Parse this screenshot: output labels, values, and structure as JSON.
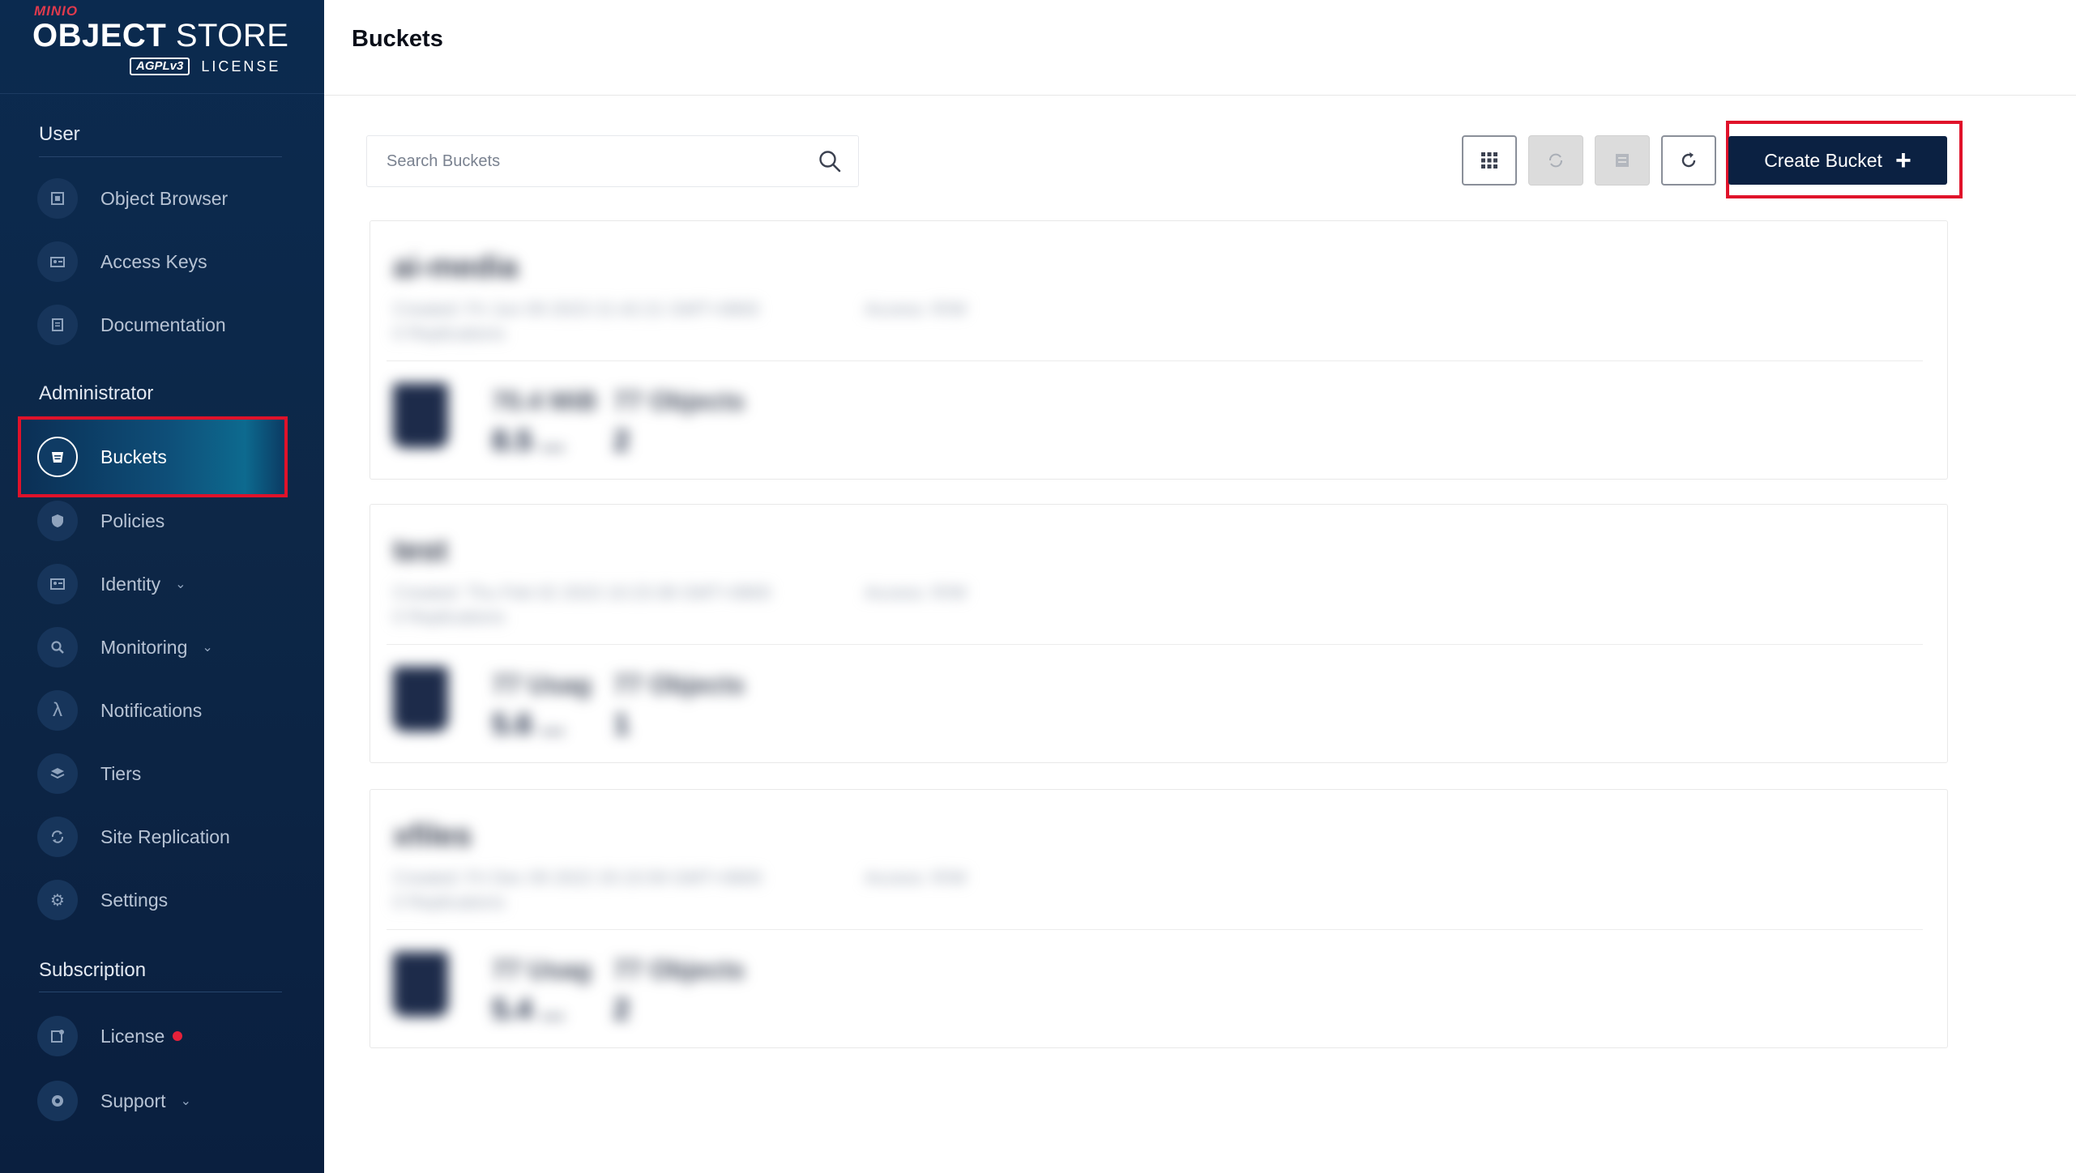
{
  "brand": {
    "minio": "MINIO",
    "title_bold": "OBJECT",
    "title_light": " STORE",
    "agpl": "AGPLv3",
    "license": "LICENSE"
  },
  "sidebar": {
    "sections": [
      {
        "title": "User"
      },
      {
        "title": "Administrator"
      },
      {
        "title": "Subscription"
      }
    ],
    "user_items": [
      {
        "label": "Object Browser",
        "icon": "object-browser-icon"
      },
      {
        "label": "Access Keys",
        "icon": "access-keys-icon"
      },
      {
        "label": "Documentation",
        "icon": "documentation-icon"
      }
    ],
    "admin_items": [
      {
        "label": "Buckets",
        "icon": "bucket-icon",
        "active": true
      },
      {
        "label": "Policies",
        "icon": "shield-icon"
      },
      {
        "label": "Identity",
        "icon": "identity-icon",
        "expandable": true
      },
      {
        "label": "Monitoring",
        "icon": "monitoring-icon",
        "expandable": true
      },
      {
        "label": "Notifications",
        "icon": "lambda-icon"
      },
      {
        "label": "Tiers",
        "icon": "tiers-icon"
      },
      {
        "label": "Site Replication",
        "icon": "replication-icon"
      },
      {
        "label": "Settings",
        "icon": "gear-icon"
      }
    ],
    "subscription_items": [
      {
        "label": "License",
        "icon": "license-icon",
        "badge": "red-dot"
      },
      {
        "label": "Support",
        "icon": "support-icon",
        "expandable": true
      }
    ]
  },
  "header": {
    "title": "Buckets"
  },
  "toolbar": {
    "search_placeholder": "Search Buckets",
    "create_label": "Create Bucket",
    "buttons": [
      {
        "name": "grid-view",
        "state": "enabled"
      },
      {
        "name": "bucket-replication",
        "state": "disabled"
      },
      {
        "name": "bucket-lifecycle",
        "state": "disabled"
      },
      {
        "name": "refresh",
        "state": "enabled"
      }
    ]
  },
  "buckets": [
    {
      "name": "ai-media",
      "created": "Created: Fri Jun 09 2023 21:42:21 GMT+0800",
      "access": "Access: R/W",
      "meta2": "0 Replications",
      "stat1": "70.4 MiB",
      "stat1_value": "8.5 ...",
      "stat2": "77 Objects",
      "stat2_value": "2"
    },
    {
      "name": "test",
      "created": "Created: Thu Feb 02 2023 10:23:38 GMT+0800",
      "access": "Access: R/W",
      "meta2": "0 Replications",
      "stat1": "77 Usag",
      "stat1_value": "5.6 ...",
      "stat2": "77 Objects",
      "stat2_value": "1"
    },
    {
      "name": "xfiles",
      "created": "Created: Fri Dec 09 2022 20:15:59 GMT+0800",
      "access": "Access: R/W",
      "meta2": "0 Replications",
      "stat1": "77 Usag",
      "stat1_value": "5.4 ...",
      "stat2": "77 Objects",
      "stat2_value": "2"
    }
  ]
}
